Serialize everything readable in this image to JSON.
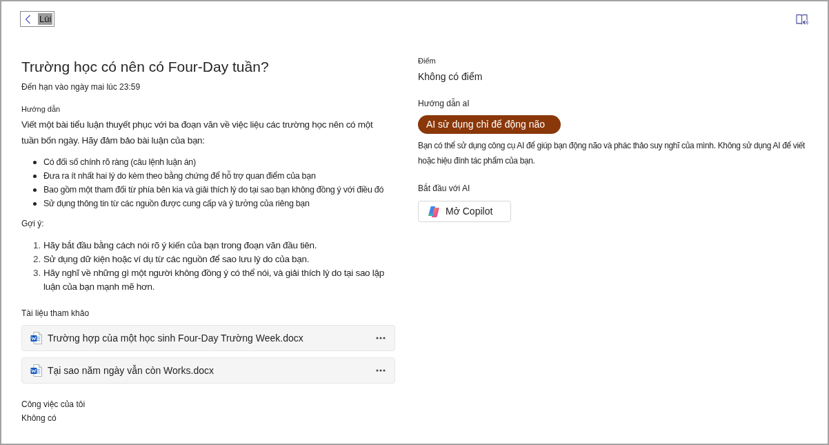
{
  "back_button": {
    "label": "Lùi",
    "highlighted": true
  },
  "assignment": {
    "title": "Trường học có nên có Four-Day tuần?",
    "due": "Đến hạn vào ngày mai lúc 23:59",
    "instructions": {
      "label": "Hướng dẫn",
      "intro": "Viết một bài tiểu luận thuyết phục với ba đoạn văn về việc liệu các trường học nên có một tuần bốn ngày. Hãy đảm bảo bài luận của bạn:",
      "bullets": [
        "Có đối số chính rõ ràng (câu lệnh luận án)",
        "Đưa ra ít nhất hai lý do kèm theo bằng chứng để hỗ trợ quan điểm của bạn",
        "Bao gồm một tham đối từ phía bên kia và giải thích lý do tại sao bạn không đồng ý với điều đó",
        "Sử dụng thông tin từ các nguồn được cung cấp và ý tưởng của riêng bạn"
      ],
      "hints_label": "Gợi ý:",
      "hints": [
        {
          "number": "1.",
          "text": "Hãy bắt đầu bằng cách nói rõ ý kiến của bạn trong đoạn văn đầu tiên."
        },
        {
          "number": "2.",
          "text": "Sử dụng dữ kiện hoặc ví dụ từ các nguồn để sao lưu lý do của bạn."
        },
        {
          "number": "3.",
          "text": "Hãy nghĩ về những gì một người không đồng ý có thể nói, và giải thích lý do tại sao lập luận của bạn mạnh mẽ hơn."
        }
      ]
    },
    "references": {
      "label": "Tài liệu tham khảo",
      "files": [
        {
          "name": "Trường hợp của một học sinh Four-Day Trường Week.docx"
        },
        {
          "name": "Tại sao năm ngày vẫn còn Works.docx"
        }
      ]
    },
    "my_work": {
      "label": "Công việc của tôi",
      "value": "Không có"
    }
  },
  "points": {
    "label": "Điểm",
    "value": "Không có điểm"
  },
  "ai_guidance": {
    "label": "Hướng dẫn aI",
    "badge": "AI sử dụng chỉ để động não",
    "description": "Bạn có thể sử dụng công cụ AI để giúp bạn động não và phác thảo suy nghĩ của mình. Không sử dụng AI để viết hoặc hiệu đính tác phẩm của bạn."
  },
  "start_ai": {
    "label": "Bắt đầu với AI",
    "button": "Mở Copilot"
  }
}
